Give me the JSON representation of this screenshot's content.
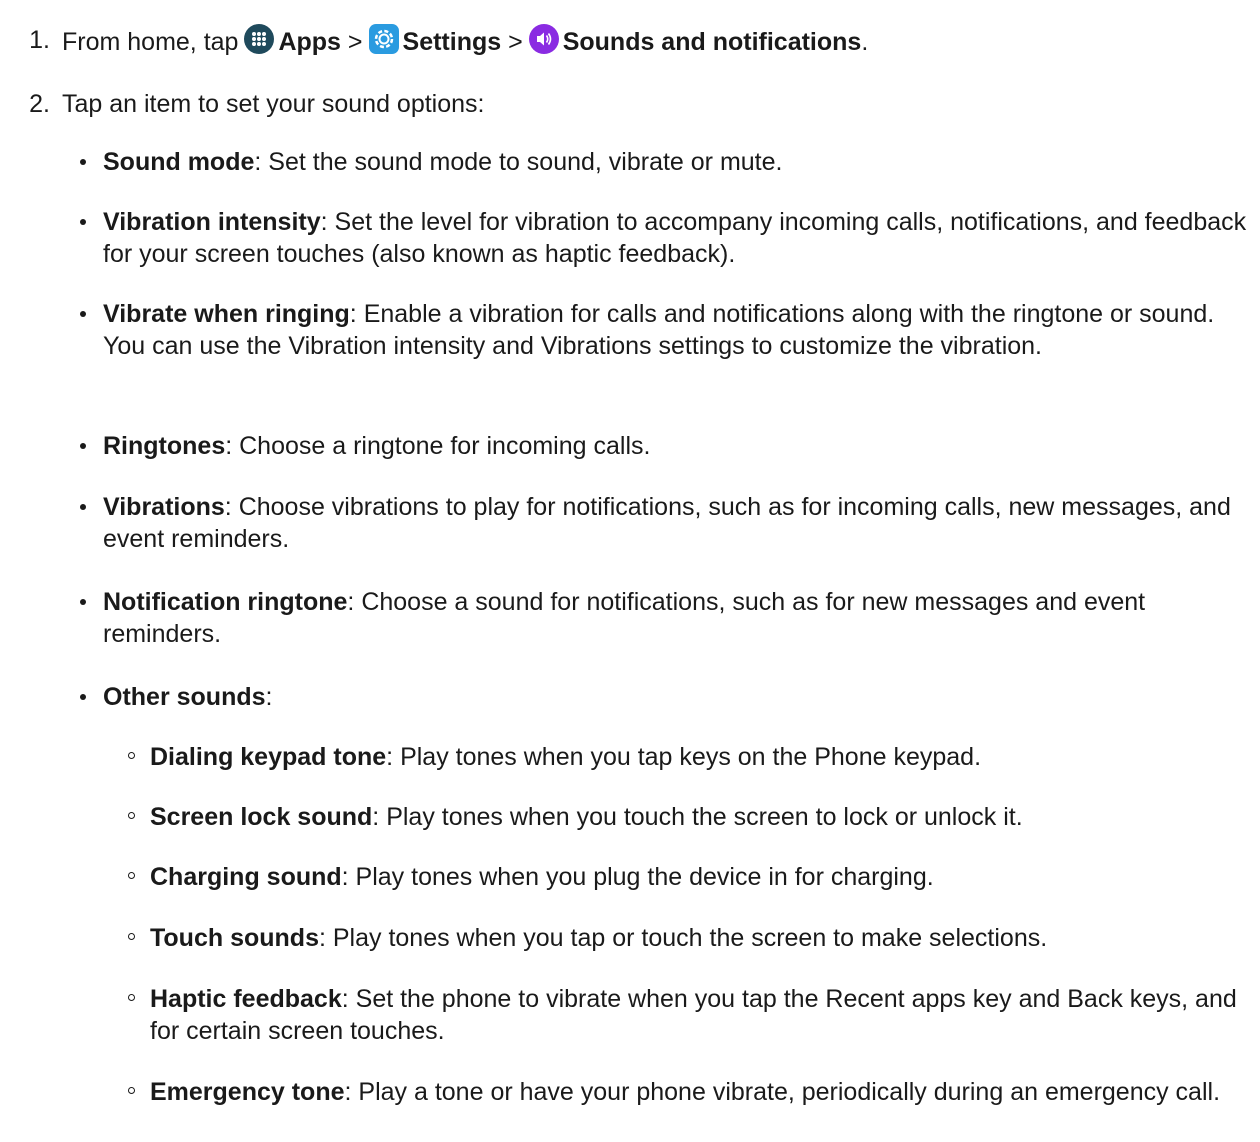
{
  "step1": {
    "number": "1.",
    "prefix": "From home, tap",
    "apps": "Apps",
    "sep1": ">",
    "settings": "Settings",
    "sep2": ">",
    "sounds": "Sounds and notifications",
    "end": "."
  },
  "step2": {
    "number": "2.",
    "text": "Tap an item to set your sound options:"
  },
  "icons": {
    "apps": "apps-grid-icon",
    "settings": "settings-gear-icon",
    "sounds": "speaker-volume-icon",
    "apps_color": "#1f4a5c",
    "settings_color": "#2a9be0",
    "sounds_color": "#8a2be2"
  },
  "options": [
    {
      "term": "Sound mode",
      "desc": ": Set the sound mode to sound, vibrate or mute."
    },
    {
      "term": "Vibration intensity",
      "desc": ": Set the level for vibration to accompany incoming calls, notifications, and feedback for your screen touches (also known as haptic feedback)."
    },
    {
      "term": "Vibrate when ringing",
      "desc": ": Enable a vibration for calls and notifications along with the ringtone or sound. You can use the Vibration intensity and Vibrations settings to customize the vibration."
    },
    {
      "term": "Ringtones",
      "desc": ": Choose a ringtone for incoming calls."
    },
    {
      "term": "Vibrations",
      "desc": ": Choose vibrations to play for notifications, such as for incoming calls, new messages, and event reminders."
    },
    {
      "term": "Notification ringtone",
      "desc": ": Choose a sound for notifications, such as for new messages and event reminders."
    },
    {
      "term": "Other sounds",
      "desc": ":"
    }
  ],
  "other_sounds": [
    {
      "term": "Dialing keypad tone",
      "desc": ": Play tones when you tap keys on the Phone keypad."
    },
    {
      "term": "Screen lock sound",
      "desc": ": Play tones when you touch the screen to lock or unlock it."
    },
    {
      "term": "Charging sound",
      "desc": ": Play tones when you plug the device in for charging."
    },
    {
      "term": "Touch sounds",
      "desc": ": Play tones when you tap or touch the screen to make selections."
    },
    {
      "term": "Haptic feedback",
      "desc": ": Set the phone to vibrate when you tap the Recent apps key and Back keys, and for certain screen touches."
    },
    {
      "term": "Emergency tone",
      "desc": ": Play a tone or have your phone vibrate, periodically during an emergency call."
    }
  ]
}
